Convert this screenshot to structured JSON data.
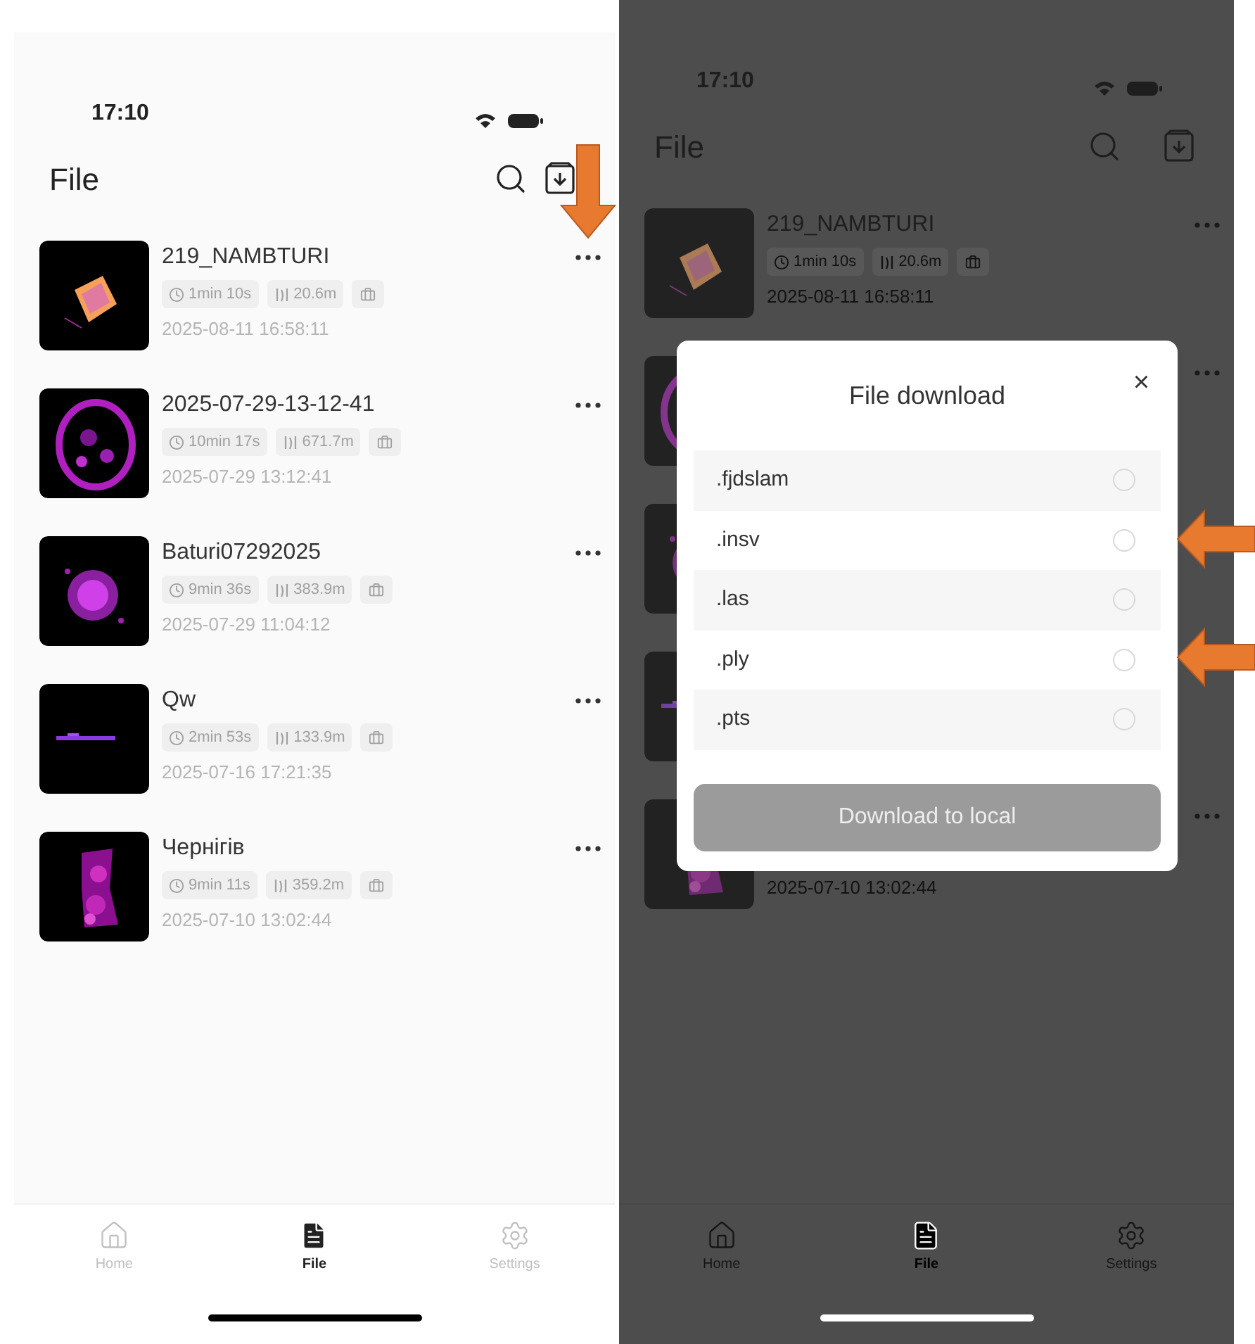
{
  "screens": [
    {
      "status_time": "17:10",
      "title": "File",
      "dimmed": false,
      "files": [
        {
          "name": "219_NAMBTURI",
          "duration": "1min 10s",
          "distance": "20.6m",
          "date": "2025-08-11 16:58:11",
          "more": true
        },
        {
          "name": "2025-07-29-13-12-41",
          "duration": "10min 17s",
          "distance": "671.7m",
          "date": "2025-07-29 13:12:41",
          "more": true
        },
        {
          "name": "Baturi07292025",
          "duration": "9min 36s",
          "distance": "383.9m",
          "date": "2025-07-29 11:04:12",
          "more": true
        },
        {
          "name": "Qw",
          "duration": "2min 53s",
          "distance": "133.9m",
          "date": "2025-07-16 17:21:35",
          "more": true
        },
        {
          "name": "Чернігів",
          "duration": "9min 11s",
          "distance": "359.2m",
          "date": "2025-07-10 13:02:44",
          "more": true
        }
      ],
      "tabs": [
        {
          "label": "Home",
          "kind": "home",
          "selected": false
        },
        {
          "label": "File",
          "kind": "file",
          "selected": true
        },
        {
          "label": "Settings",
          "kind": "settings",
          "selected": false
        }
      ]
    },
    {
      "status_time": "17:10",
      "title": "File",
      "dimmed": true,
      "files": [
        {
          "name": "219_NAMBTURI",
          "duration": "1min 10s",
          "distance": "20.6m",
          "date": "2025-08-11 16:58:11",
          "more": true
        },
        {
          "more": true
        },
        {
          "more": false
        },
        {
          "more": false
        },
        {
          "date": "2025-07-10 13:02:44",
          "more": true
        }
      ],
      "tabs": [
        {
          "label": "Home",
          "kind": "home",
          "selected": false
        },
        {
          "label": "File",
          "kind": "file",
          "selected": true
        },
        {
          "label": "Settings",
          "kind": "settings",
          "selected": false
        }
      ],
      "dialog": {
        "title": "File download",
        "close": "×",
        "options": [
          {
            "label": ".fjdslam",
            "selected": false
          },
          {
            "label": ".insv",
            "selected": false
          },
          {
            "label": ".las",
            "selected": false
          },
          {
            "label": ".ply",
            "selected": false
          },
          {
            "label": ".pts",
            "selected": false
          }
        ],
        "button": "Download to local"
      }
    }
  ]
}
